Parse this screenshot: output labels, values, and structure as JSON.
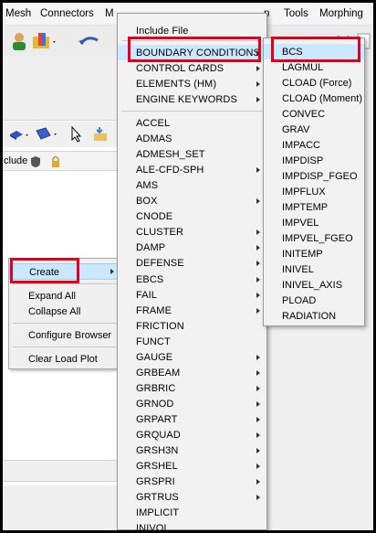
{
  "menubar": {
    "items": [
      "Mesh",
      "Connectors",
      "M",
      "p",
      "Tools",
      "Morphing"
    ]
  },
  "browser": {
    "column_header": "clude"
  },
  "context_menu": {
    "items": [
      {
        "label": "Create",
        "submenu": true,
        "highlighted": true
      },
      {
        "label": "Expand All"
      },
      {
        "label": "Collapse All"
      },
      {
        "label": "Configure Browser"
      },
      {
        "label": "Clear Load Plot"
      }
    ]
  },
  "create_menu": {
    "items": [
      {
        "label": "Include File",
        "submenu": false
      },
      {
        "label": "BOUNDARY CONDITIONS",
        "submenu": true,
        "highlighted": true
      },
      {
        "label": "CONTROL CARDS",
        "submenu": true
      },
      {
        "label": "ELEMENTS (HM)",
        "submenu": true
      },
      {
        "label": "ENGINE KEYWORDS",
        "submenu": true
      },
      {
        "label": "ACCEL",
        "submenu": false
      },
      {
        "label": "ADMAS",
        "submenu": false
      },
      {
        "label": "ADMESH_SET",
        "submenu": false
      },
      {
        "label": "ALE-CFD-SPH",
        "submenu": true
      },
      {
        "label": "AMS",
        "submenu": false
      },
      {
        "label": "BOX",
        "submenu": true
      },
      {
        "label": "CNODE",
        "submenu": false
      },
      {
        "label": "CLUSTER",
        "submenu": true
      },
      {
        "label": "DAMP",
        "submenu": true
      },
      {
        "label": "DEFENSE",
        "submenu": true
      },
      {
        "label": "EBCS",
        "submenu": true
      },
      {
        "label": "FAIL",
        "submenu": true
      },
      {
        "label": "FRAME",
        "submenu": true
      },
      {
        "label": "FRICTION",
        "submenu": false
      },
      {
        "label": "FUNCT",
        "submenu": false
      },
      {
        "label": "GAUGE",
        "submenu": true
      },
      {
        "label": "GRBEAM",
        "submenu": true
      },
      {
        "label": "GRBRIC",
        "submenu": true
      },
      {
        "label": "GRNOD",
        "submenu": true
      },
      {
        "label": "GRPART",
        "submenu": true
      },
      {
        "label": "GRQUAD",
        "submenu": true
      },
      {
        "label": "GRSH3N",
        "submenu": true
      },
      {
        "label": "GRSHEL",
        "submenu": true
      },
      {
        "label": "GRSPRI",
        "submenu": true
      },
      {
        "label": "GRTRUS",
        "submenu": true
      },
      {
        "label": "IMPLICIT",
        "submenu": false
      },
      {
        "label": "INIVOL",
        "submenu": false
      }
    ]
  },
  "bc_menu": {
    "items": [
      "BCS",
      "LAGMUL",
      "CLOAD (Force)",
      "CLOAD (Moment)",
      "CONVEC",
      "GRAV",
      "IMPACC",
      "IMPDISP",
      "IMPDISP_FGEO",
      "IMPFLUX",
      "IMPTEMP",
      "IMPVEL",
      "IMPVEL_FGEO",
      "INITEMP",
      "INIVEL",
      "INIVEL_AXIS",
      "PLOAD",
      "RADIATION"
    ],
    "highlighted": "BCS"
  },
  "colors": {
    "highlight": "#cce8ff",
    "annotation_red": "#e0001b",
    "menu_bg": "#f2f2f2"
  }
}
